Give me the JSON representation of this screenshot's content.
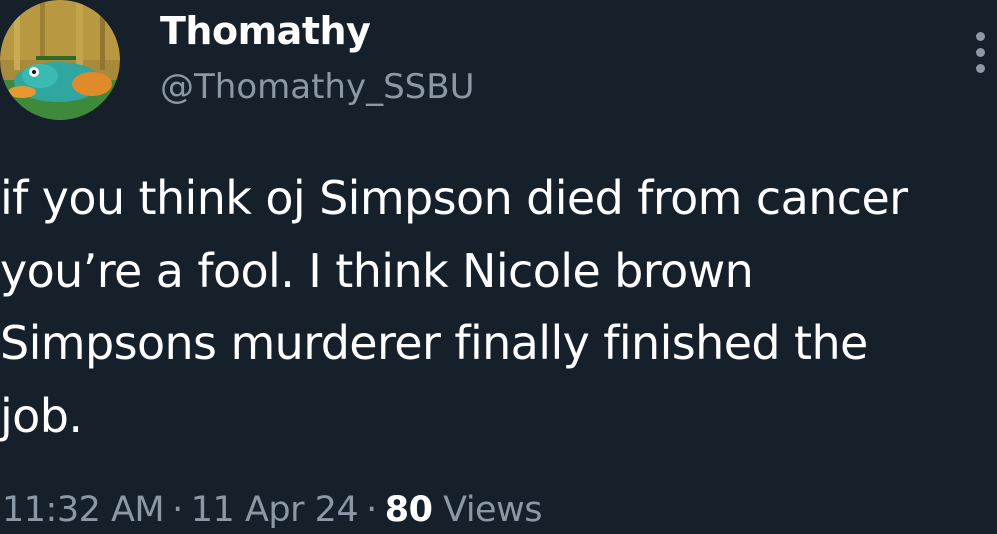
{
  "author": {
    "display_name": "Thomathy",
    "handle": "@Thomathy_SSBU",
    "avatar_icon": "perry-platypus-avatar"
  },
  "tweet": {
    "text_lines": [
      "if you think oj Simpson died from cancer",
      "you’re a fool. I think Nicole brown",
      "Simpsons murderer finally finished the",
      "job."
    ]
  },
  "meta": {
    "time": "11:32 AM",
    "separator": "·",
    "date": "11 Apr 24",
    "views_count": "80",
    "views_label": "Views"
  },
  "icons": {
    "more": "more-vertical-icon"
  },
  "colors": {
    "background": "#15202b",
    "primary_text": "#ffffff",
    "secondary_text": "#8b98a5"
  }
}
